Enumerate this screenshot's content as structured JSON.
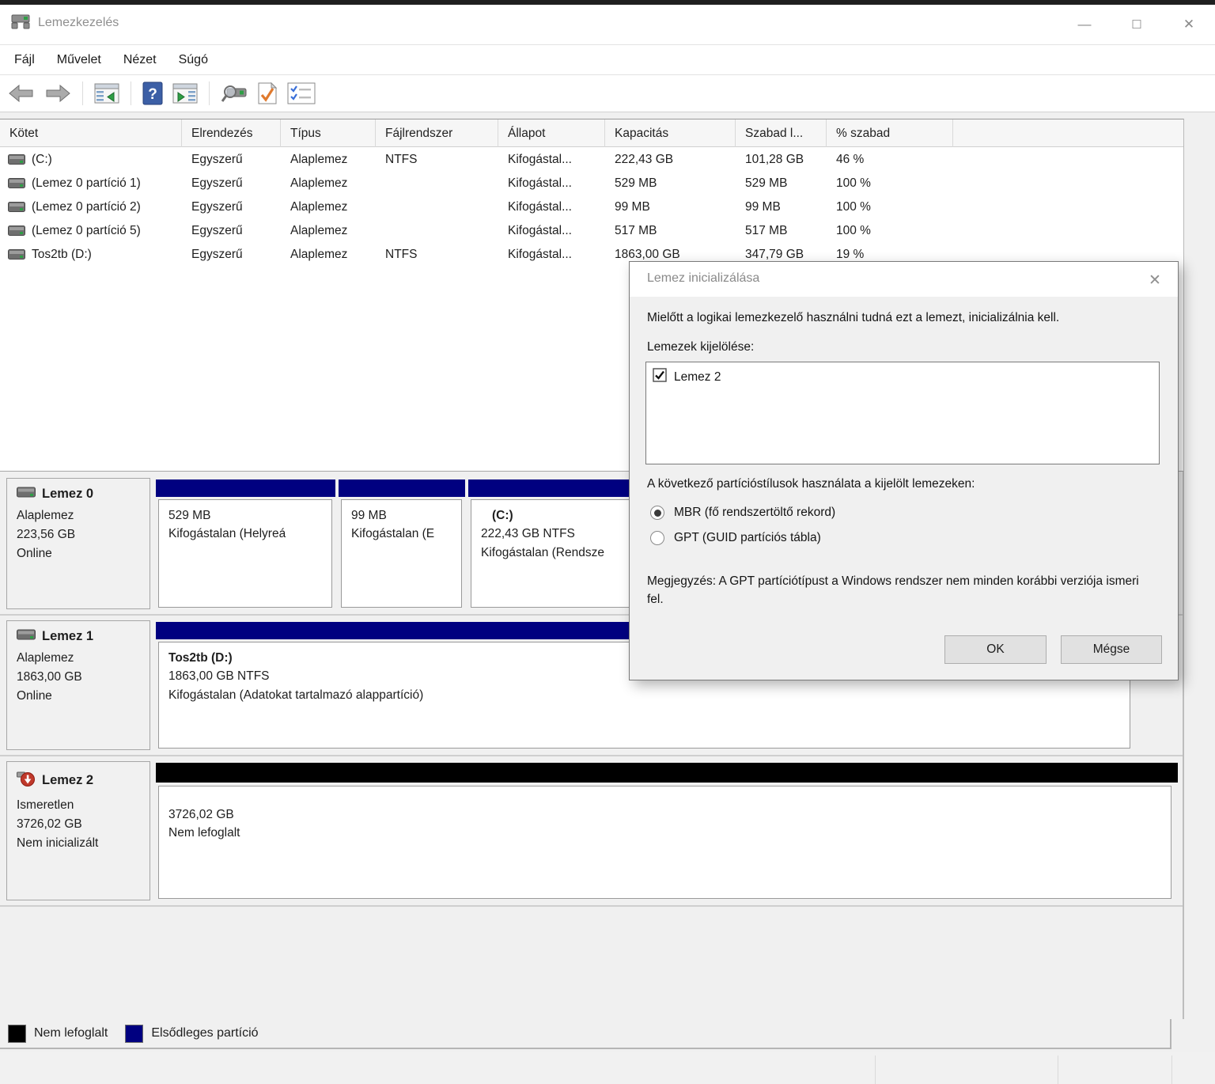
{
  "window": {
    "title": "Lemezkezelés",
    "minimize_glyph": "—",
    "maximize_glyph": "☐",
    "close_glyph": "✕"
  },
  "menu": {
    "items": [
      "Fájl",
      "Művelet",
      "Nézet",
      "Súgó"
    ]
  },
  "toolbar": {
    "icons": [
      "back",
      "forward",
      "console-tree",
      "help",
      "show-hide-console-tree",
      "disk-search",
      "check-document",
      "checklist"
    ]
  },
  "volume_table": {
    "columns": [
      "Kötet",
      "Elrendezés",
      "Típus",
      "Fájlrendszer",
      "Állapot",
      "Kapacitás",
      "Szabad l...",
      "% szabad",
      ""
    ],
    "rows": [
      {
        "volume": "(C:)",
        "layout": "Egyszerű",
        "type": "Alaplemez",
        "fs": "NTFS",
        "status": "Kifogástal...",
        "capacity": "222,43 GB",
        "free": "101,28 GB",
        "pct": "46 %"
      },
      {
        "volume": "(Lemez 0 partíció 1)",
        "layout": "Egyszerű",
        "type": "Alaplemez",
        "fs": "",
        "status": "Kifogástal...",
        "capacity": "529 MB",
        "free": "529 MB",
        "pct": "100 %"
      },
      {
        "volume": "(Lemez 0 partíció 2)",
        "layout": "Egyszerű",
        "type": "Alaplemez",
        "fs": "",
        "status": "Kifogástal...",
        "capacity": "99 MB",
        "free": "99 MB",
        "pct": "100 %"
      },
      {
        "volume": "(Lemez 0 partíció 5)",
        "layout": "Egyszerű",
        "type": "Alaplemez",
        "fs": "",
        "status": "Kifogástal...",
        "capacity": "517 MB",
        "free": "517 MB",
        "pct": "100 %"
      },
      {
        "volume": "Tos2tb (D:)",
        "layout": "Egyszerű",
        "type": "Alaplemez",
        "fs": "NTFS",
        "status": "Kifogástal...",
        "capacity": "1863,00 GB",
        "free": "347,79 GB",
        "pct": "19 %"
      }
    ]
  },
  "disks": [
    {
      "name": "Lemez 0",
      "type": "Alaplemez",
      "size": "223,56 GB",
      "status": "Online",
      "partitions": [
        {
          "title": "",
          "size_line": "529 MB",
          "status_line": "Kifogástalan (Helyreá"
        },
        {
          "title": "",
          "size_line": "99 MB",
          "status_line": "Kifogástalan (E"
        },
        {
          "title": "(C:)",
          "size_line": "222,43 GB NTFS",
          "status_line": "Kifogástalan (Rendsze"
        }
      ]
    },
    {
      "name": "Lemez 1",
      "type": "Alaplemez",
      "size": "1863,00 GB",
      "status": "Online",
      "partitions": [
        {
          "title": "Tos2tb (D:)",
          "size_line": "1863,00 GB NTFS",
          "status_line": "Kifogástalan (Adatokat tartalmazó alappartíció)"
        }
      ]
    },
    {
      "name": "Lemez 2",
      "type": "Ismeretlen",
      "size": "3726,02 GB",
      "status": "Nem inicializált",
      "partitions": [
        {
          "title": "",
          "size_line": "3726,02 GB",
          "status_line": "Nem lefoglalt"
        }
      ]
    }
  ],
  "legend": {
    "unallocated_label": "Nem lefoglalt",
    "primary_label": "Elsődleges partíció"
  },
  "dialog": {
    "title": "Lemez inicializálása",
    "close_glyph": "✕",
    "intro": "Mielőtt a logikai lemezkezelő használni tudná ezt a lemezt, inicializálnia kell.",
    "select_label": "Lemezek kijelölése:",
    "disk_item": "Lemez 2",
    "styles_label": "A következő partícióstílusok használata a kijelölt lemezeken:",
    "mbr_label": "MBR (fő rendszertöltő rekord)",
    "gpt_label": "GPT (GUID partíciós tábla)",
    "note": "Megjegyzés: A GPT partíciótípust a Windows rendszer nem minden korábbi verziója ismeri fel.",
    "ok_label": "OK",
    "cancel_label": "Mégse"
  },
  "colors": {
    "primary_partition": "#000080",
    "unallocated": "#000000",
    "disk_error_badge": "#c0392b"
  }
}
